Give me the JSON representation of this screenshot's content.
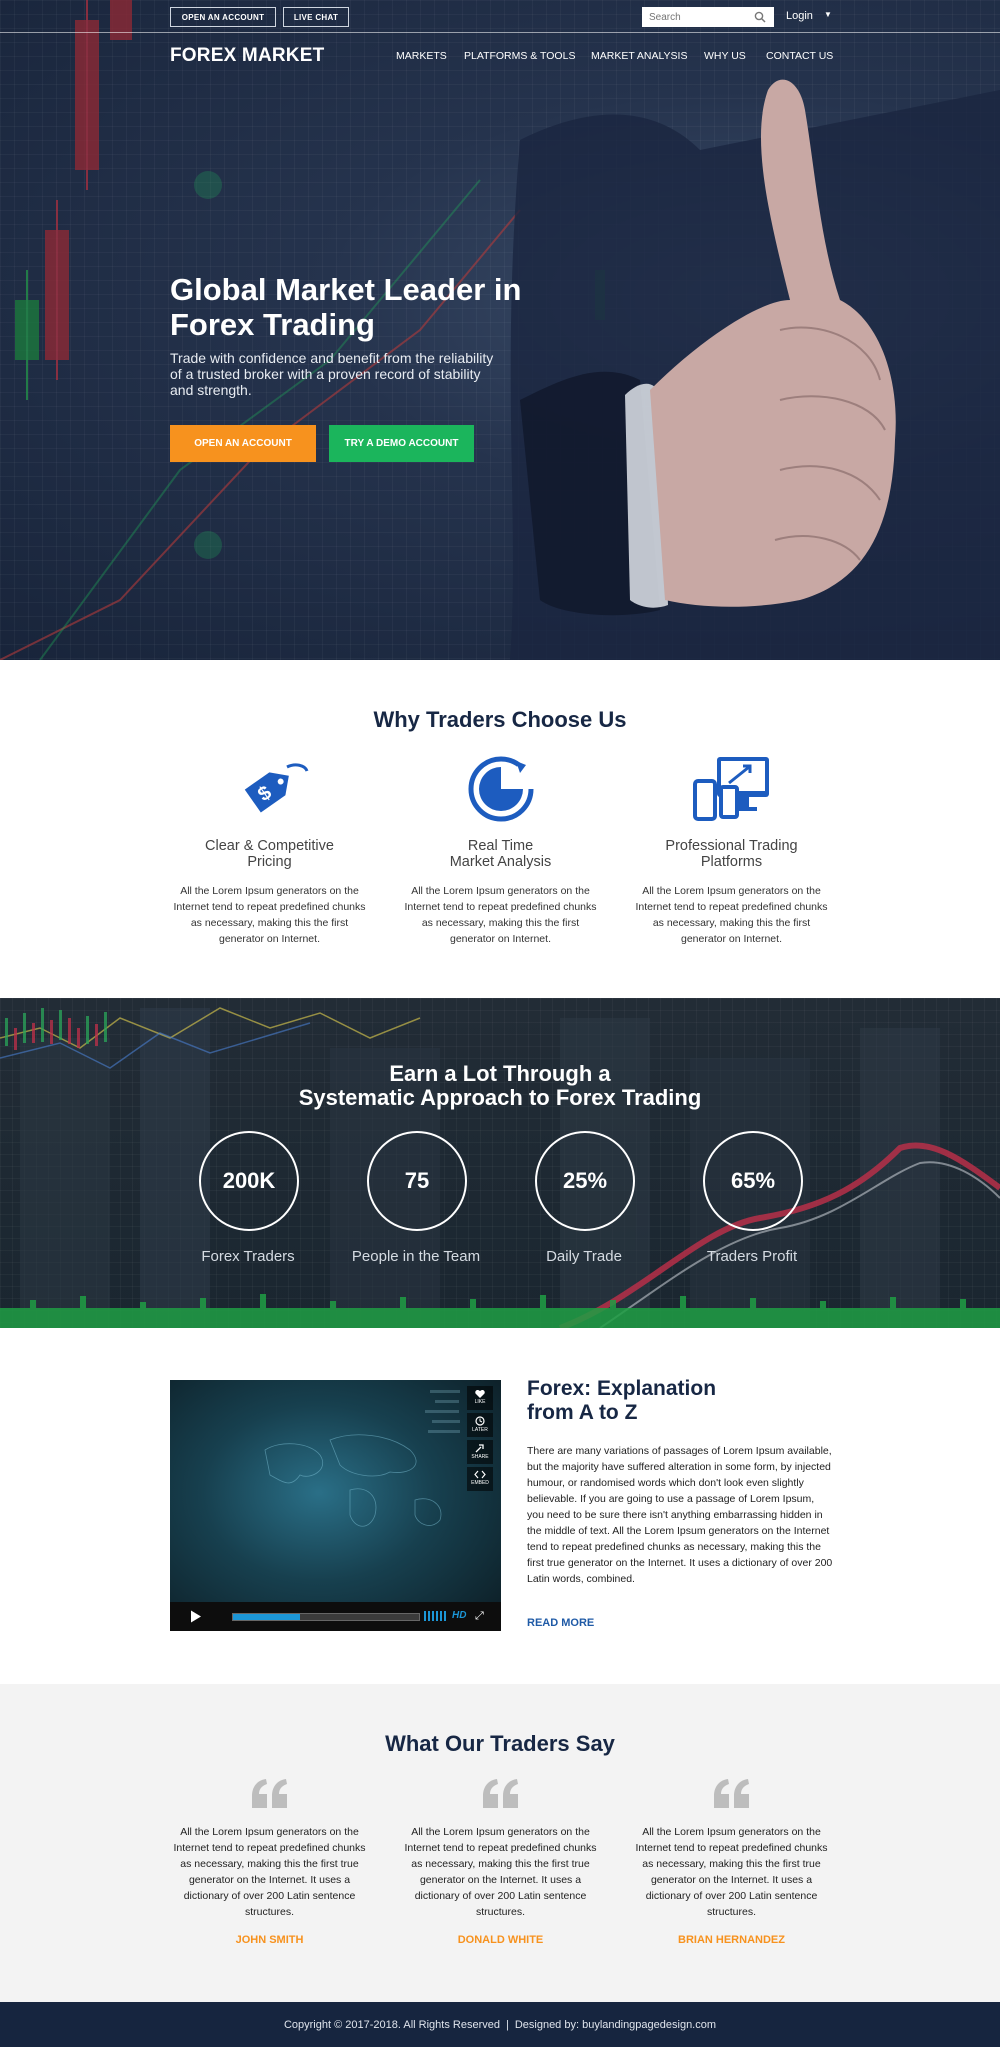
{
  "topbar": {
    "open_account": "OPEN AN ACCOUNT",
    "live_chat": "LIVE CHAT",
    "search_placeholder": "Search",
    "login": "Login",
    "login_caret": "▼"
  },
  "header": {
    "logo": "FOREX MARKET",
    "nav": [
      "MARKETS",
      "PLATFORMS & TOOLS",
      "MARKET ANALYSIS",
      "WHY US",
      "CONTACT US"
    ]
  },
  "hero": {
    "title": "Global Market Leader in Forex Trading",
    "subtitle": "Trade with confidence and benefit from the reliability of a trusted broker with a proven record of stability and strength.",
    "cta_primary": "OPEN AN ACCOUNT",
    "cta_secondary": "TRY A DEMO ACCOUNT"
  },
  "why": {
    "title": "Why Traders Choose Us",
    "features": [
      {
        "icon": "price-tag-icon",
        "title_line1": "Clear & Competitive",
        "title_line2": "Pricing",
        "text": "All the Lorem Ipsum generators on the Internet tend to repeat predefined chunks as necessary, making this the first generator on Internet."
      },
      {
        "icon": "pie-chart-icon",
        "title_line1": "Real Time",
        "title_line2": "Market Analysis",
        "text": "All the Lorem Ipsum generators on the Internet tend to repeat predefined chunks as necessary, making this the first generator on Internet."
      },
      {
        "icon": "devices-icon",
        "title_line1": "Professional Trading",
        "title_line2": "Platforms",
        "text": "All the Lorem Ipsum generators on the Internet tend to repeat predefined chunks as necessary, making this the first generator on Internet."
      }
    ]
  },
  "stats": {
    "title_line1": "Earn a Lot Through a",
    "title_line2": "Systematic Approach to Forex Trading",
    "items": [
      {
        "value": "200K",
        "label": "Forex Traders"
      },
      {
        "value": "75",
        "label": "People in the Team"
      },
      {
        "value": "25%",
        "label": "Daily Trade"
      },
      {
        "value": "65%",
        "label": "Traders Profit"
      }
    ]
  },
  "video": {
    "like": "LIKE",
    "later": "LATER",
    "share": "SHARE",
    "embed": "EMBED",
    "hd": "HD",
    "progress": 0.36
  },
  "article": {
    "title_line1": "Forex: Explanation",
    "title_line2": "from A to Z",
    "text": "There are many variations of passages of Lorem Ipsum available, but the majority have suffered alteration in some form, by injected humour, or randomised words which don't look even slightly believable. If you are going to use a passage of Lorem Ipsum, you need to be sure there isn't anything embarrassing hidden in the middle of text. All the Lorem Ipsum generators on the Internet tend to repeat predefined chunks as necessary, making this the first true generator on the Internet. It uses a dictionary of over 200 Latin words, combined.",
    "read_more": "READ MORE"
  },
  "testimonials": {
    "title": "What Our Traders Say",
    "items": [
      {
        "text": "All the Lorem Ipsum generators on the Internet tend to repeat predefined chunks as necessary, making this the first true generator on the Internet. It uses a dictionary of over 200 Latin sentence structures.",
        "name": "JOHN SMITH"
      },
      {
        "text": "All the Lorem Ipsum generators on the Internet tend to repeat predefined chunks as necessary, making this the first true generator on the Internet. It uses a dictionary of over 200 Latin sentence structures.",
        "name": "DONALD WHITE"
      },
      {
        "text": "All the Lorem Ipsum generators on the Internet tend to repeat predefined chunks as necessary, making this the first true generator on the Internet. It uses a dictionary of over 200 Latin sentence structures.",
        "name": "BRIAN HERNANDEZ"
      }
    ]
  },
  "footer": {
    "copyright": "Copyright © 2017-2018. All Rights Reserved",
    "separator": "|",
    "designed_by": "Designed by: buylandingpagedesign.com"
  },
  "colors": {
    "accent_orange": "#f7921e",
    "accent_green": "#1bb55c",
    "brand_blue": "#1d5cbf",
    "navy": "#16253f"
  }
}
